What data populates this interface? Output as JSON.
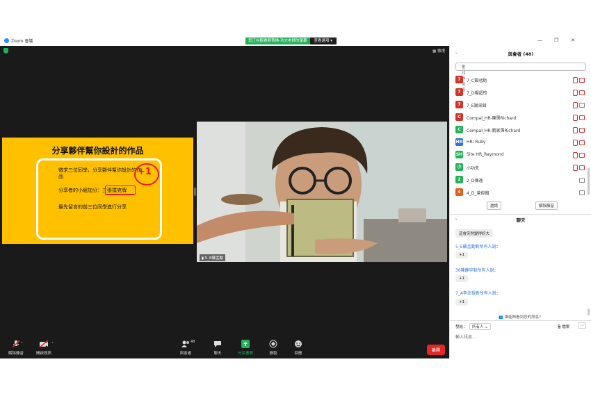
{
  "window": {
    "app_title": "Zoom 會議",
    "banner_text": "您正在觀看劉首佛-功夫老師的螢幕",
    "banner_button": "查看選項",
    "view_label": "檢視"
  },
  "slide": {
    "title": "分享夥伴幫你設計的作品",
    "line1": "徵求三位同學，分享夥伴幫你設計的作品",
    "line2": "分享者的小組加分：三張撲克牌",
    "line3": "最先留言的前三位同學進行分享",
    "annotation": "+1"
  },
  "video": {
    "name": "5_E蘇孟勳"
  },
  "toolbar": {
    "unmute": "解除靜音",
    "start_video": "開啟視訊",
    "participants": "與會者",
    "participants_count": "48",
    "chat": "聊天",
    "share": "分享畫面",
    "record": "錄製",
    "reactions": "回應",
    "leave": "離開",
    "share_color": "#23b15a",
    "leave_color": "#e02828"
  },
  "participants": {
    "title": "與會者 (48)",
    "search_placeholder": "查找與會者",
    "list": [
      {
        "initial": "7",
        "name": "7_C黃冠勳",
        "color": "#d5332a",
        "mic": "off",
        "video": "off"
      },
      {
        "initial": "7",
        "name": "7_D楊超筠",
        "color": "#d5332a",
        "mic": "off",
        "video": "off"
      },
      {
        "initial": "7",
        "name": "7_E謝采錡",
        "color": "#d5332a",
        "mic": "off",
        "video": "on"
      },
      {
        "initial": "C",
        "name": "Compal_HR-陳霈Richard",
        "color": "#d5332a",
        "mic": "off",
        "video": "off"
      },
      {
        "initial": "C",
        "name": "Compal_HR-劉家霈Richard",
        "color": "#23b15a",
        "mic": "off",
        "video": "off"
      },
      {
        "initial": "HR",
        "name": "HR: Ruby",
        "color": "#2d74d8",
        "mic": "off",
        "video": "off"
      },
      {
        "initial": "SH",
        "name": "Site HR_Raymond",
        "color": "#23b15a",
        "mic": "off",
        "video": "off"
      },
      {
        "initial": "小",
        "name": "小功夫",
        "color": "#23b15a",
        "mic": "off",
        "video": "off"
      },
      {
        "initial": "2",
        "name": "2_D陳逸",
        "color": "#23b15a",
        "mic": "none",
        "video": "on"
      },
      {
        "initial": "4",
        "name": "4_D_曾俊翰",
        "color": "#e65c1a",
        "mic": "none",
        "video": "on"
      }
    ],
    "invite_button": "邀請",
    "unmute_all_button": "解除靜音"
  },
  "chat": {
    "title": "聊天",
    "messages": [
      {
        "sender": "",
        "text": "這會突然變得好大"
      },
      {
        "sender": "5_E蘇孟勳對所有人說：",
        "text": "+1"
      },
      {
        "sender": "36陳靜宇對所有人說：",
        "text": "+1"
      },
      {
        "sender": "7_A李念祖對所有人說：",
        "text": "+1"
      }
    ],
    "who_can_see": "誰能夠看到您的訊息？",
    "to_label": "發給：",
    "to_value": "所有人",
    "file_label": "檔案",
    "input_placeholder": "輸入訊息..."
  }
}
